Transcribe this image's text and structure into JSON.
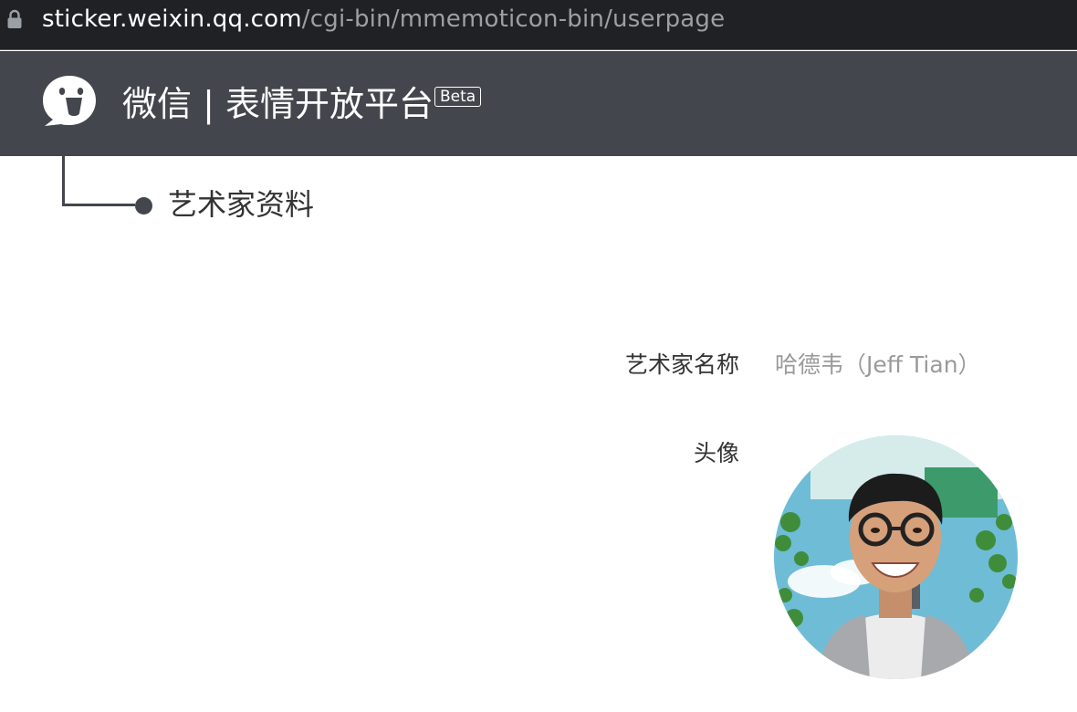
{
  "browser": {
    "url_host": "sticker.weixin.qq.com",
    "url_path": "/cgi-bin/mmemoticon-bin/userpage",
    "lock_icon": "lock-icon"
  },
  "header": {
    "logo_icon": "wechat-sticker-logo-icon",
    "brand": "微信 | 表情开放平台",
    "badge": "Beta",
    "background_color": "#44464d"
  },
  "section": {
    "title": "艺术家资料"
  },
  "profile": {
    "name_label": "艺术家名称",
    "name_value": "哈德韦（Jeff Tian）",
    "avatar_label": "头像",
    "avatar_icon": "artist-avatar"
  }
}
